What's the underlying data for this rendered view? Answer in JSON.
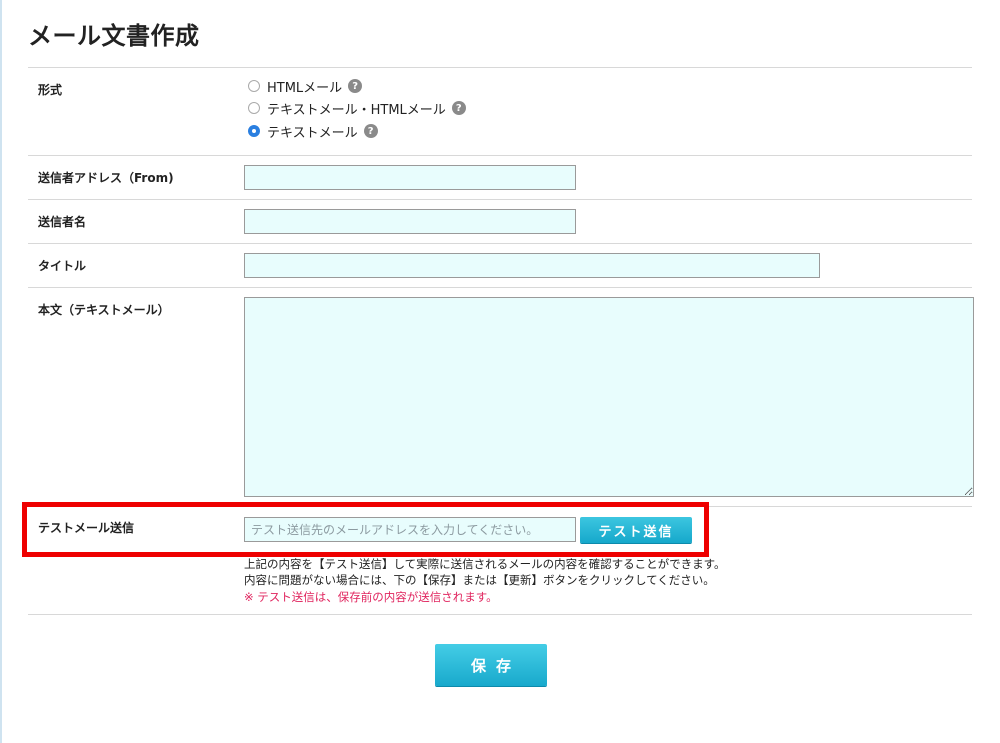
{
  "page": {
    "title": "メール文書作成"
  },
  "format": {
    "label": "形式",
    "options": [
      {
        "label": "HTMLメール",
        "checked": false
      },
      {
        "label": "テキストメール・HTMLメール",
        "checked": false
      },
      {
        "label": "テキストメール",
        "checked": true
      }
    ],
    "help_glyph": "?"
  },
  "from": {
    "label": "送信者アドレス（From)",
    "value": ""
  },
  "sender_name": {
    "label": "送信者名",
    "value": ""
  },
  "title": {
    "label": "タイトル",
    "value": ""
  },
  "body": {
    "label": "本文（テキストメール）",
    "value": ""
  },
  "test": {
    "label": "テストメール送信",
    "placeholder": "テスト送信先のメールアドレスを入力してください。",
    "button": "テスト送信",
    "note1": "上記の内容を【テスト送信】して実際に送信されるメールの内容を確認することができます。",
    "note2": "内容に問題がない場合には、下の【保存】または【更新】ボタンをクリックしてください。",
    "note3": "※ テスト送信は、保存前の内容が送信されます。"
  },
  "save_button": "保存",
  "colors": {
    "accent": "#1aaacc",
    "input_bg": "#e8fdfd",
    "highlight": "#ee0000",
    "warning_text": "#e0245e",
    "radio_checked": "#2a7fe0"
  }
}
